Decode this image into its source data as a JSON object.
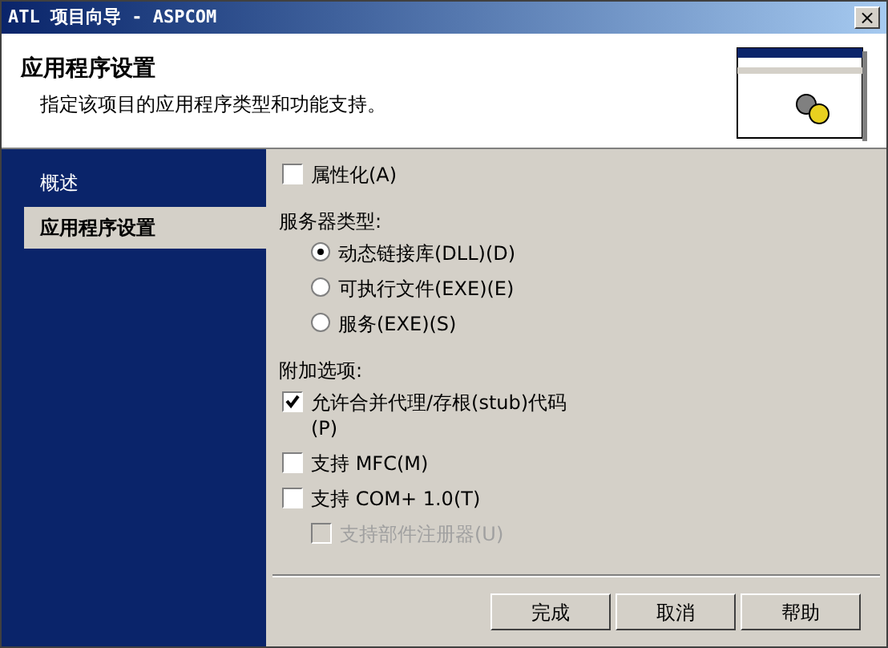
{
  "window": {
    "title": "ATL 项目向导 - ASPCOM",
    "close": "×"
  },
  "header": {
    "title": "应用程序设置",
    "subtitle": "指定该项目的应用程序类型和功能支持。"
  },
  "sidebar": {
    "items": [
      {
        "label": "概述",
        "selected": false
      },
      {
        "label": "应用程序设置",
        "selected": true
      }
    ]
  },
  "options": [
    {
      "kind": "checkbox",
      "label": "属性化(A)",
      "checked": false,
      "disabled": false,
      "indent": false
    },
    {
      "kind": "heading",
      "label": "服务器类型:"
    },
    {
      "kind": "radio",
      "label": "动态链接库(DLL)(D)",
      "selected": true
    },
    {
      "kind": "radio",
      "label": "可执行文件(EXE)(E)",
      "selected": false
    },
    {
      "kind": "radio",
      "label": "服务(EXE)(S)",
      "selected": false
    },
    {
      "kind": "heading",
      "label": "附加选项:"
    },
    {
      "kind": "checkbox",
      "label": "允许合并代理/存根(stub)代码(P)",
      "checked": true,
      "disabled": false,
      "indent": false
    },
    {
      "kind": "checkbox",
      "label": "支持 MFC(M)",
      "checked": false,
      "disabled": false,
      "indent": false
    },
    {
      "kind": "checkbox",
      "label": "支持 COM+ 1.0(T)",
      "checked": false,
      "disabled": false,
      "indent": false
    },
    {
      "kind": "checkbox",
      "label": "支持部件注册器(U)",
      "checked": false,
      "disabled": true,
      "indent": true
    }
  ],
  "buttons": [
    "完成",
    "取消",
    "帮助"
  ]
}
